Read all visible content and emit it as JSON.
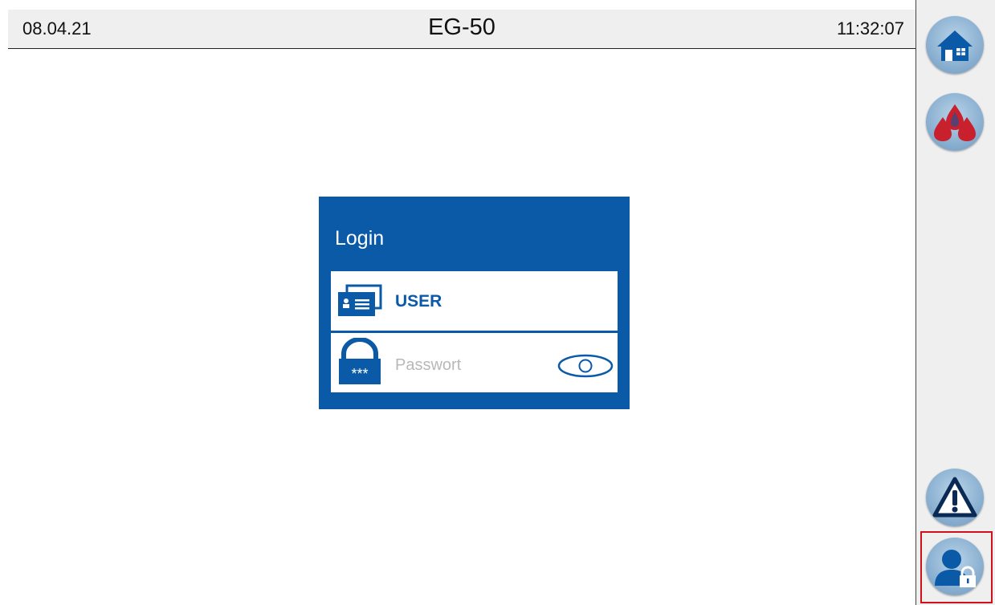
{
  "header": {
    "date": "08.04.21",
    "title": "EG-50",
    "time": "11:32:07"
  },
  "login": {
    "title": "Login",
    "user_label": "USER",
    "password_placeholder": "Passwort",
    "password_icon_text": "***"
  },
  "sidebar": {
    "items": [
      {
        "icon": "home-icon"
      },
      {
        "icon": "fire-icon"
      },
      {
        "icon": "warning-icon"
      },
      {
        "icon": "user-lock-icon",
        "selected": true
      }
    ]
  },
  "colors": {
    "accent": "#0a5aa8",
    "selection_border": "#d0101a"
  }
}
